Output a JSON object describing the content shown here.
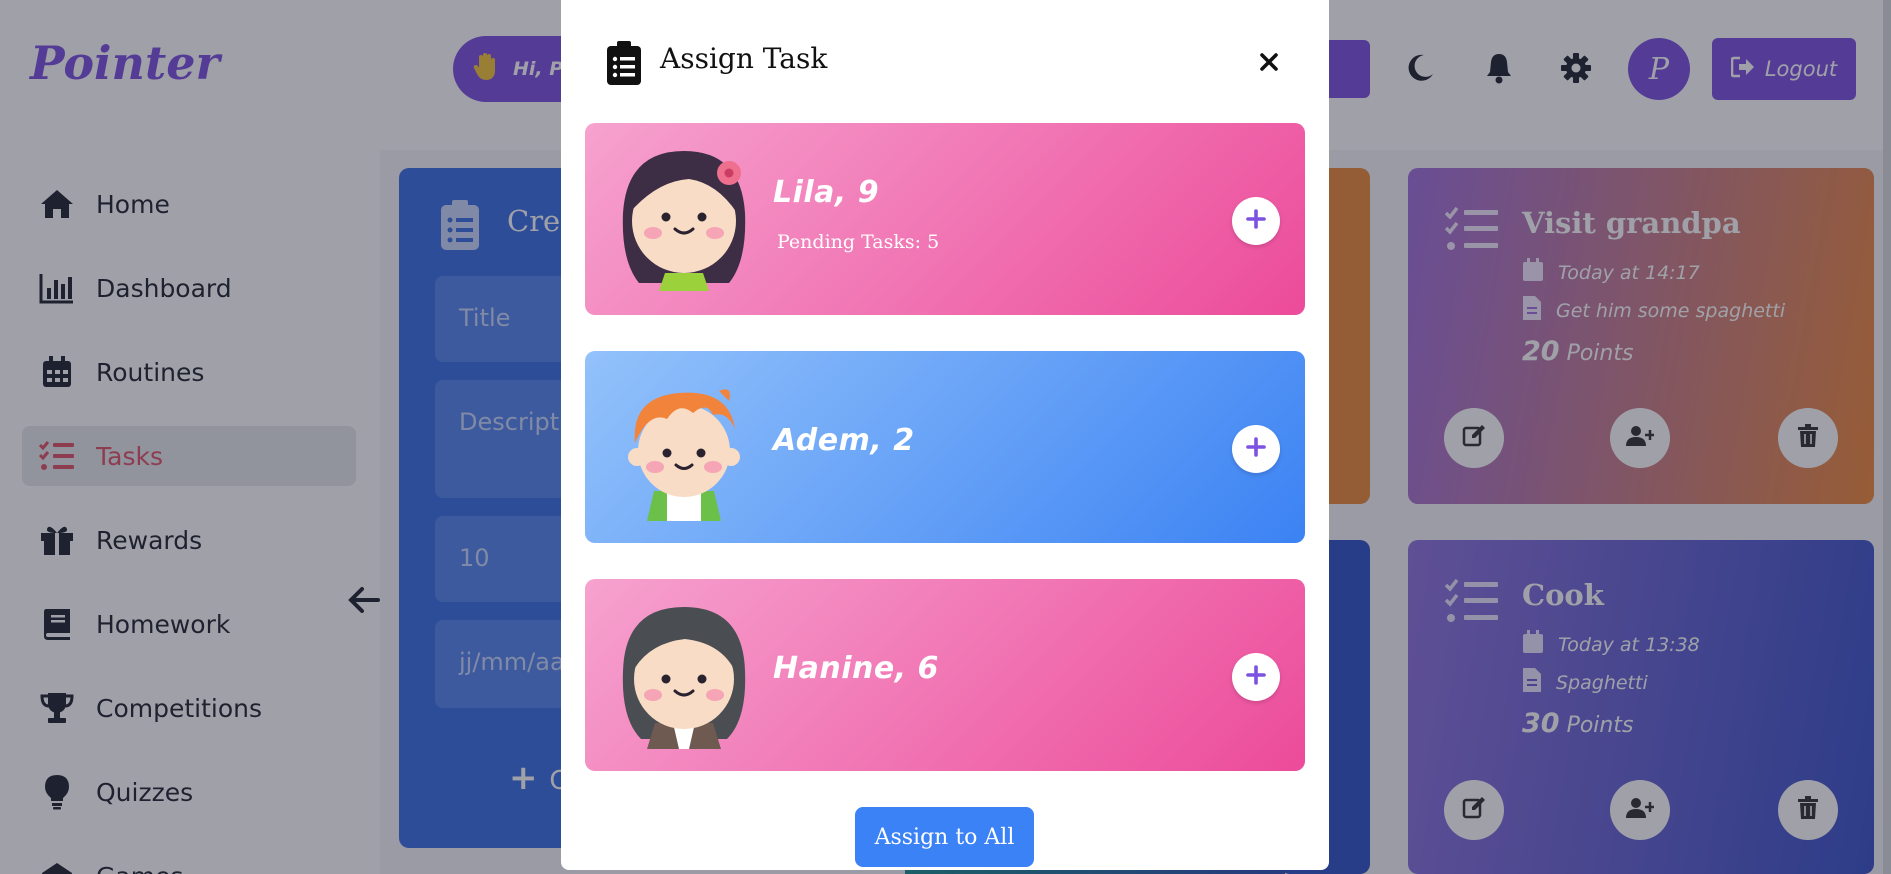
{
  "header": {
    "logo": "Pointer",
    "greeting": "Hi, Pe",
    "avatar_letter": "P",
    "logout_label": "Logout",
    "icons": [
      "moon-icon",
      "bell-icon",
      "gear-icon"
    ]
  },
  "sidebar": {
    "items": [
      {
        "label": "Home",
        "icon": "home-icon"
      },
      {
        "label": "Dashboard",
        "icon": "chart-icon"
      },
      {
        "label": "Routines",
        "icon": "calendar-icon"
      },
      {
        "label": "Tasks",
        "icon": "tasks-icon",
        "active": true
      },
      {
        "label": "Rewards",
        "icon": "gift-icon"
      },
      {
        "label": "Homework",
        "icon": "book-icon"
      },
      {
        "label": "Competitions",
        "icon": "trophy-icon"
      },
      {
        "label": "Quizzes",
        "icon": "bulb-icon"
      },
      {
        "label": "Games",
        "icon": "gamepad-icon"
      }
    ]
  },
  "create_form": {
    "title": "Crea",
    "title_placeholder": "Title",
    "description_placeholder": "Descripti",
    "points_value": "10",
    "date_placeholder": "jj/mm/aa",
    "create_label": "C"
  },
  "tasks": [
    {
      "title": "Visit grandpa",
      "date": "Today at 14:17",
      "description": "Get him some spaghetti",
      "points": "20",
      "points_label": "Points"
    },
    {
      "title": "Cook",
      "date": "Today at 13:38",
      "description": "Spaghetti",
      "points": "30",
      "points_label": "Points"
    }
  ],
  "modal": {
    "title": "Assign Task",
    "children": [
      {
        "name": "Lila, 9",
        "pending": "Pending Tasks: 5",
        "color": "pink"
      },
      {
        "name": "Adem, 2",
        "pending": "",
        "color": "blue"
      },
      {
        "name": "Hanine, 6",
        "pending": "",
        "color": "pink"
      }
    ],
    "assign_all_label": "Assign to All"
  },
  "colors": {
    "brand_purple": "#7c52e0",
    "active_red": "#e0536a",
    "assign_blue": "#3b82f6",
    "pink": "#ec4b9a"
  }
}
